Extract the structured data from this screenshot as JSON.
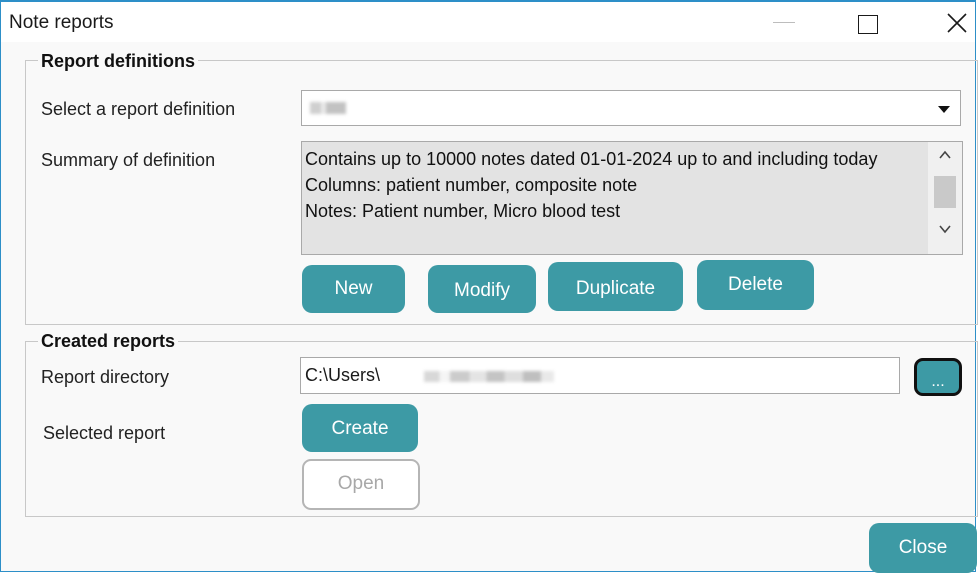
{
  "window": {
    "title": "Note reports"
  },
  "report_definitions": {
    "legend": "Report definitions",
    "select_label": "Select a report definition",
    "summary_label": "Summary of definition",
    "summary": {
      "line1": "Contains up to 10000 notes dated 01-01-2024 up to and including today",
      "line2": "Columns: patient number, composite note",
      "line3": "Notes: Patient number, Micro blood test"
    },
    "buttons": {
      "new": "New",
      "modify": "Modify",
      "duplicate": "Duplicate",
      "delete": "Delete"
    }
  },
  "created_reports": {
    "legend": "Created reports",
    "directory_label": "Report directory",
    "directory_value": "C:\\Users\\",
    "browse_label": "...",
    "selected_label": "Selected report",
    "buttons": {
      "create": "Create",
      "open": "Open"
    }
  },
  "footer": {
    "close": "Close"
  },
  "colors": {
    "accent": "#3d9aa5",
    "window_border": "#2d8fc8"
  }
}
